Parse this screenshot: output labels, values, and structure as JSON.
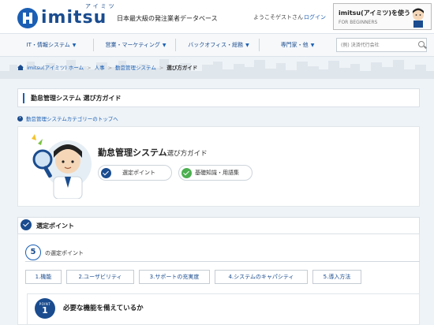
{
  "header": {
    "logo_text": "imitsu",
    "logo_kana": "アイミツ",
    "tagline": "日本最大級の発注業者データベース",
    "welcome": "ようこそゲストさん",
    "login": "ログイン",
    "beginner_title": "imitsu(アイミツ)を使う",
    "beginner_sub": "FOR BEGINNERS"
  },
  "nav": {
    "items": [
      {
        "label": "IT・情報システム"
      },
      {
        "label": "営業・マーケティング"
      },
      {
        "label": "バックオフィス・総務"
      },
      {
        "label": "専門家・他"
      }
    ],
    "search_placeholder": "(例) 決済代行会社"
  },
  "breadcrumb": {
    "items": [
      "imitsu(アイミツ) ホーム",
      "人事",
      "勤怠管理システム"
    ],
    "current": "選び方ガイド"
  },
  "page_title": "勤怠管理システム 選び方ガイド",
  "category_link": "勤怠管理システムカテゴリーのトップへ",
  "hero": {
    "title_main": "勤怠管理システム",
    "title_sub": "選び方ガイド",
    "pill_1": "選定ポイント",
    "pill_2": "基礎知識・用語集",
    "color_pill_1": "#1a4c8f",
    "color_pill_2": "#4caf50"
  },
  "section": {
    "title": "選定ポイント",
    "count": "5",
    "count_label": "の選定ポイント",
    "tabs": [
      "1.機能",
      "2.ユーザビリティ",
      "3.サポートの充実度",
      "4.システムのキャパシティ",
      "5.導入方法"
    ]
  },
  "point": {
    "word": "POINT",
    "number": "1",
    "title": "必要な機能を備えているか"
  }
}
